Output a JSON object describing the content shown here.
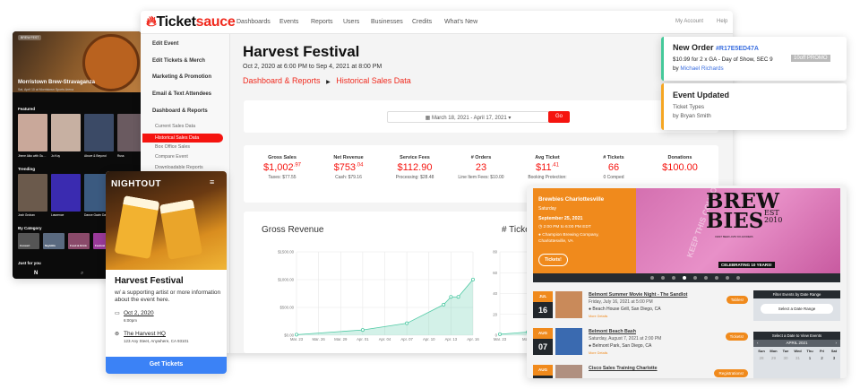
{
  "dashboard": {
    "logo": {
      "part1": "Ticket",
      "part2": "sauce"
    },
    "nav": [
      "Dashboards",
      "Events",
      "Reports",
      "Users",
      "Businesses",
      "Credits",
      "What's New"
    ],
    "nav_right": [
      "My Account",
      "Help"
    ],
    "sidebar": {
      "headers": [
        "Edit Event",
        "Edit Tickets & Merch",
        "Marketing & Promotion",
        "Email & Text Attendees",
        "Dashboard & Reports"
      ],
      "subitems": [
        "Current Sales Data",
        "Historical Sales Data",
        "Box Office Sales",
        "Compare Event",
        "Downloadable Reports"
      ],
      "active": "Historical Sales Data"
    },
    "title": "Harvest Festival",
    "dates": "Oct 2, 2020 at 6:00 PM to Sep 4, 2021 at 8:00 PM",
    "breadcrumb": [
      "Dashboard & Reports",
      "Historical Sales Data"
    ],
    "date_picker": "March 18, 2021 - April 17, 2021 ▾",
    "go_label": "Go",
    "stats": [
      {
        "label": "Gross Sales",
        "value": "$1,002",
        "cents": ".97",
        "sub": "Taxes: $77.55"
      },
      {
        "label": "Net Revenue",
        "value": "$753",
        "cents": ".04",
        "sub": "Cash: $79.16"
      },
      {
        "label": "Service Fees",
        "value": "$112.90",
        "cents": "",
        "sub": "Processing: $28.48"
      },
      {
        "label": "# Orders",
        "value": "23",
        "cents": "",
        "sub": "Line Item Fees: $10.00"
      },
      {
        "label": "Avg Ticket",
        "value": "$11",
        "cents": ".41",
        "sub": "Booking Protection:"
      },
      {
        "label": "# Tickets",
        "value": "66",
        "cents": "",
        "sub": "0 Comped"
      },
      {
        "label": "Donations",
        "value": "$100.00",
        "cents": "",
        "sub": ""
      }
    ]
  },
  "chart_data": [
    {
      "type": "area",
      "title": "Gross Revenue",
      "x_ticks": [
        "Mar. 23",
        "Mar. 26",
        "Mar. 29",
        "Apr. 01",
        "Apr. 04",
        "Apr. 07",
        "Apr. 10",
        "Apr. 13",
        "Apr. 16"
      ],
      "y_ticks": [
        "$0.00",
        "$500.00",
        "$1000.00",
        "$1500.00"
      ],
      "ylim": [
        0,
        1500
      ],
      "x_days": [
        0,
        9,
        15,
        20,
        21,
        22,
        24
      ],
      "x_labels": [
        "Mar. 23",
        "Apr. 01",
        "Apr. 07",
        "Apr. 12",
        "Apr. 13",
        "Apr. 14",
        "Apr. 16"
      ],
      "values": [
        10,
        95,
        215,
        550,
        690,
        690,
        1003
      ],
      "grid": true,
      "color": "#4fc9a4"
    },
    {
      "type": "area",
      "title": "# Tickets",
      "x_ticks": [
        "Mar. 23",
        "Mar. 2"
      ],
      "y_ticks": [
        "0",
        "20",
        "40",
        "60",
        "80"
      ],
      "ylim": [
        0,
        80
      ],
      "x_days": [
        0,
        3
      ],
      "values": [
        1,
        3
      ],
      "grid": true,
      "color": "#4fc9a4"
    }
  ],
  "phone": {
    "badge": "BREW FEST",
    "hero_title": "Morristown Brew-Stravaganza",
    "hero_sub": "Sat, April 10 at Morristown Sports Arena",
    "sections": [
      "Featured",
      "Trending",
      "By Category",
      "Just for you"
    ],
    "featured": [
      "Jhene Aiko with Gu…",
      "Jo Koy",
      "Above & Beyond",
      "Russ"
    ],
    "trending": [
      "Josh Groban",
      "Lawrence",
      "Dance Gavin Dance"
    ],
    "categories": [
      "Concert",
      "Nightlife",
      "Food & Drink",
      "Festival"
    ]
  },
  "nightout": {
    "brand": "NIGHTOUT",
    "title": "Harvest Festival",
    "desc": "w/ a supporting artist or more information about the event here.",
    "date": "Oct 2, 2020",
    "time": "6:00pm",
    "venue": "The Harvest HQ",
    "address": "123 Any Steet, Anywhere, CA 93101",
    "cta": "Get Tickets"
  },
  "notifications": [
    {
      "title": "New Order",
      "id": "#R17E5ED47A",
      "line": "$10.99 for 2 x GA - Day of Show, SEC 9",
      "badge": "10off PROMO",
      "by": "by ",
      "user": "Michael Richards",
      "accent": "#45c99a"
    },
    {
      "title": "Event Updated",
      "line": "Ticket Types",
      "by": "by Bryan Smith",
      "accent": "#f5a623"
    }
  ],
  "brewbies": {
    "name": "Brewbies Charlottesville",
    "day": "Saturday",
    "date": "September 25, 2021",
    "time": "2:00 PM to 6:00 PM EDT",
    "venue": "Champion Brewing Company, Charlottesville, VA",
    "cta": "Tickets!",
    "poster": {
      "l1": "BREW",
      "l2": "BIES",
      "est": "EST",
      "year": "2010",
      "tagline": "CRAFT BEER LOVIN' DO-GOODERS",
      "banner": "CELEBRATING 10 YEARS!",
      "coupon": "KEEP THIS COUPON"
    },
    "events": [
      {
        "month": "JUL",
        "day": "16",
        "name": "Belmont Summer Movie Night - The Sandlot",
        "date": "Friday, July 16, 2021 at 5:00 PM",
        "loc": "Beach House Grill, San Diego, CA",
        "more": "More Details",
        "btn": "Tables!"
      },
      {
        "month": "AUG",
        "day": "07",
        "name": "Belmont Beach Bash",
        "date": "Saturday, August 7, 2021 at 2:00 PM",
        "loc": "Belmont Park, San Diego, CA",
        "more": "More Details",
        "btn": "Tickets!"
      },
      {
        "month": "AUG",
        "day": "",
        "name": "Cisco Sales Training Charlotte",
        "date": "",
        "loc": "",
        "more": "",
        "btn": "Registrations!"
      }
    ],
    "filter_title": "Filter Events by Date Range",
    "filter_btn": "Select a Date Range",
    "cal_title": "Select a Date to View Events",
    "cal_month": "APRIL 2021",
    "weekdays": [
      "Sun",
      "Mon",
      "Tue",
      "Wed",
      "Thu",
      "Fri",
      "Sat"
    ],
    "days": [
      "28",
      "29",
      "30",
      "31",
      "1",
      "2",
      "3"
    ]
  }
}
